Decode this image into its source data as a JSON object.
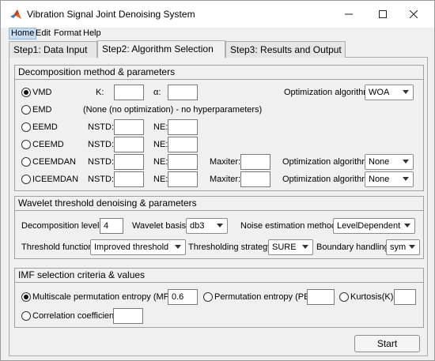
{
  "window": {
    "title": "Vibration Signal Joint Denoising System"
  },
  "menu": [
    "Home",
    "Edit",
    "Format",
    "Help"
  ],
  "tabs": [
    "Step1:  Data Input",
    "Step2:  Algorithm Selection",
    "Step3:  Results and Output"
  ],
  "decomp": {
    "title": "Decomposition method & parameters",
    "k_label": "K:",
    "alpha_label": "α:",
    "opt_label": "Optimization algorithm",
    "nstd_label": "NSTD:",
    "ne_label": "NE:",
    "maxiter_label": "Maxiter:",
    "emd_note": "(None (no optimization) - no hyperparameters)",
    "methods": [
      "VMD",
      "EMD",
      "EEMD",
      "CEEMD",
      "CEEMDAN",
      "ICEEMDAN"
    ],
    "vmd_opt": "WOA",
    "ceemdan_opt": "None",
    "iceemdan_opt": "None"
  },
  "wavelet": {
    "title": "Wavelet threshold denoising & parameters",
    "levels_label": "Decomposition levels:",
    "levels_value": "4",
    "basis_label": "Wavelet basis:",
    "basis_value": "db3",
    "noise_label": "Noise estimation method:",
    "noise_value": "LevelDependent",
    "threshold_label": "Threshold function:",
    "threshold_value": "Improved threshold",
    "strategy_label": "Thresholding strategy:",
    "strategy_value": "SURE",
    "boundary_label": "Boundary handling:",
    "boundary_value": "sym"
  },
  "imf": {
    "title": "IMF selection criteria & values",
    "mpe_label": "Multiscale permutation entropy (MPE):",
    "mpe_value": "0.6",
    "pe_label": "Permutation entropy (PE):",
    "kurt_label": "Kurtosis(K):",
    "corr_label": "Correlation coefficient:"
  },
  "start_label": "Start"
}
